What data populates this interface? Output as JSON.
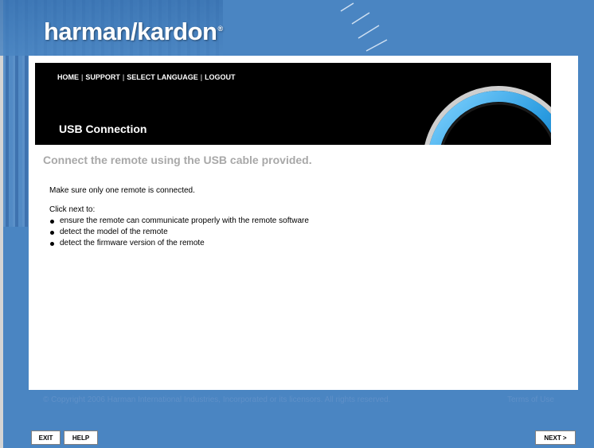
{
  "brand": {
    "logo_text": "harman/kardon",
    "registered_mark": "®"
  },
  "nav": {
    "items": [
      "HOME",
      "SUPPORT",
      "SELECT LANGUAGE",
      "LOGOUT"
    ],
    "separator": "|"
  },
  "banner": {
    "title": "USB Connection"
  },
  "page": {
    "subtitle": "Connect the remote using the USB cable provided.",
    "instruction": "Make sure only one remote is connected.",
    "click_next_intro": "Click next to:",
    "bullets": [
      "ensure the remote can communicate properly with the remote software",
      "detect the model of the remote",
      "detect the firmware version of the remote"
    ]
  },
  "footer": {
    "copyright": "© Copyright 2006 Harman International Industries, Incorporated or its licensors. All rights reserved.",
    "terms": "Terms of Use"
  },
  "buttons": {
    "exit": "EXIT",
    "help": "HELP",
    "next": "NEXT >"
  },
  "colors": {
    "background": "#4a85c2",
    "panel": "#ffffff",
    "banner": "#000000",
    "ring_accent": "#3aa8e8",
    "subtitle": "#a8a8a8",
    "footer_text": "#5f90c8"
  }
}
